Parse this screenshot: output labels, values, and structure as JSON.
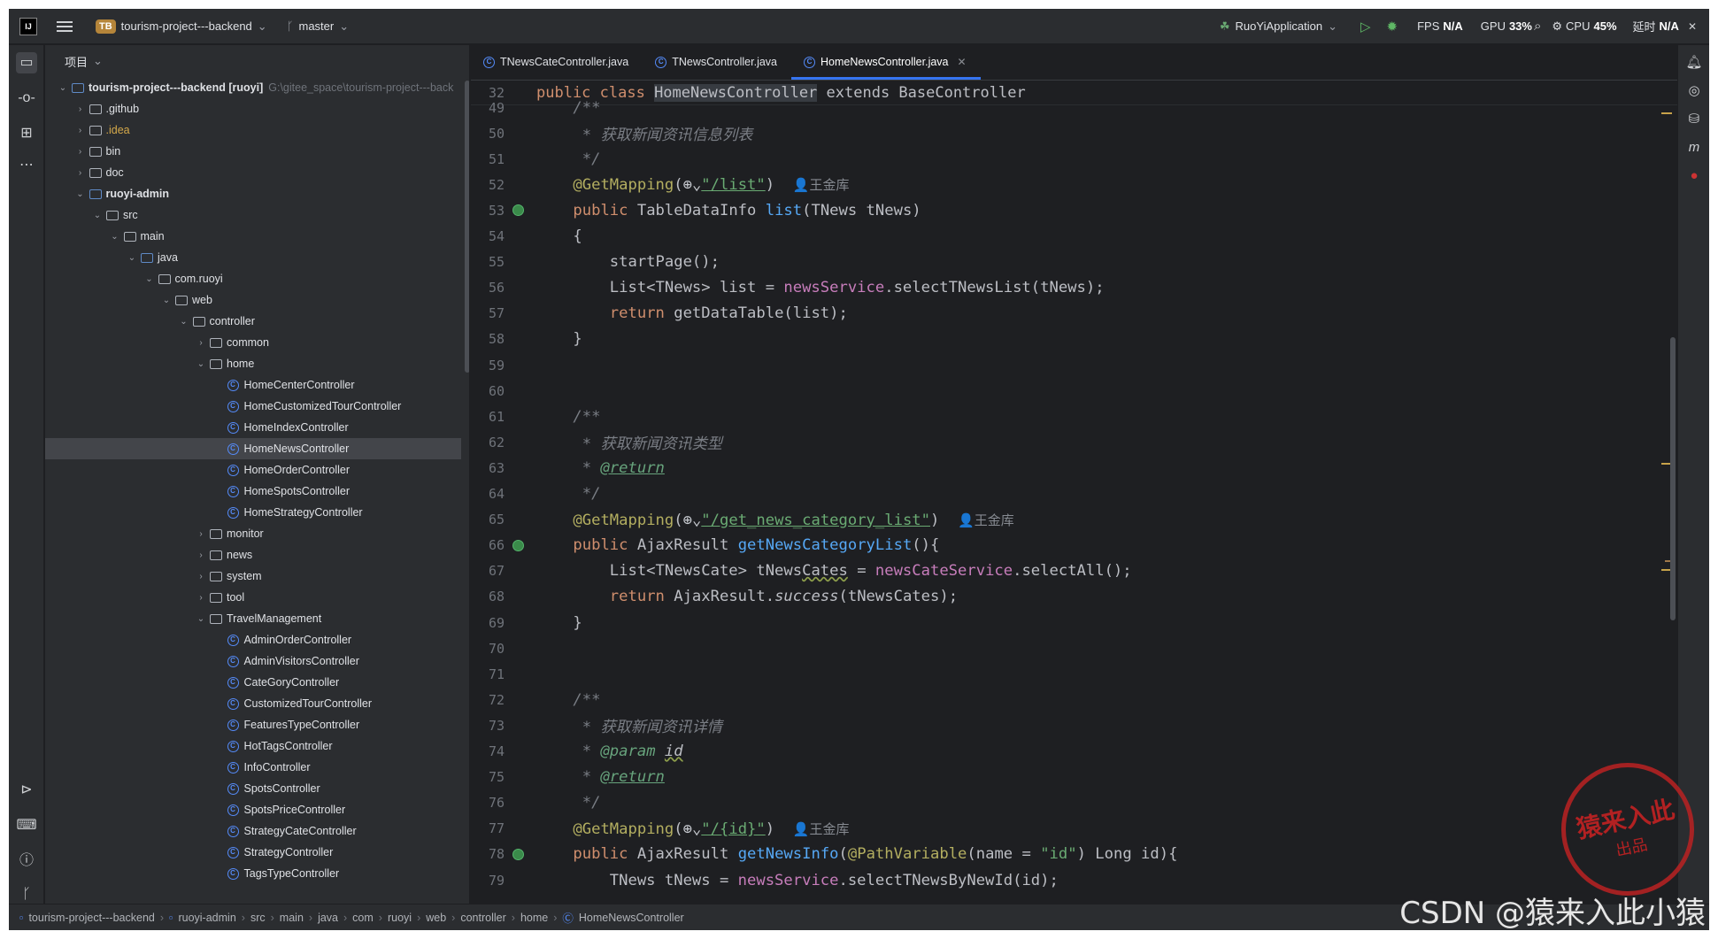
{
  "titlebar": {
    "project_badge": "TB",
    "project_name": "tourism-project---backend",
    "branch": "master",
    "run_config": "RuoYiApplication",
    "fps_label": "FPS",
    "fps_value": "N/A",
    "gpu_label": "GPU",
    "gpu_value": "33%",
    "cpu_label": "CPU",
    "cpu_value": "45%",
    "time_label": "延时",
    "time_value": "N/A"
  },
  "project_panel": {
    "title": "项目",
    "tree": [
      {
        "indent": 0,
        "chev": "v",
        "icon": "module",
        "label": "tourism-project---backend [ruoyi]",
        "hint": "G:\\gitee_space\\tourism-project---back",
        "bold": true
      },
      {
        "indent": 1,
        "chev": ">",
        "icon": "folder",
        "label": ".github"
      },
      {
        "indent": 1,
        "chev": ">",
        "icon": "folder",
        "label": ".idea",
        "cls": "idea-c"
      },
      {
        "indent": 1,
        "chev": ">",
        "icon": "folder",
        "label": "bin"
      },
      {
        "indent": 1,
        "chev": ">",
        "icon": "folder",
        "label": "doc"
      },
      {
        "indent": 1,
        "chev": "v",
        "icon": "module",
        "label": "ruoyi-admin",
        "bold": true
      },
      {
        "indent": 2,
        "chev": "v",
        "icon": "folder",
        "label": "src"
      },
      {
        "indent": 3,
        "chev": "v",
        "icon": "folder",
        "label": "main"
      },
      {
        "indent": 4,
        "chev": "v",
        "icon": "module",
        "label": "java"
      },
      {
        "indent": 5,
        "chev": "v",
        "icon": "package",
        "label": "com.ruoyi"
      },
      {
        "indent": 6,
        "chev": "v",
        "icon": "package",
        "label": "web"
      },
      {
        "indent": 7,
        "chev": "v",
        "icon": "package",
        "label": "controller"
      },
      {
        "indent": 8,
        "chev": ">",
        "icon": "package",
        "label": "common"
      },
      {
        "indent": 8,
        "chev": "v",
        "icon": "package",
        "label": "home"
      },
      {
        "indent": 9,
        "chev": "",
        "icon": "class",
        "label": "HomeCenterController"
      },
      {
        "indent": 9,
        "chev": "",
        "icon": "class",
        "label": "HomeCustomizedTourController"
      },
      {
        "indent": 9,
        "chev": "",
        "icon": "class",
        "label": "HomeIndexController"
      },
      {
        "indent": 9,
        "chev": "",
        "icon": "class",
        "label": "HomeNewsController",
        "selected": true
      },
      {
        "indent": 9,
        "chev": "",
        "icon": "class",
        "label": "HomeOrderController"
      },
      {
        "indent": 9,
        "chev": "",
        "icon": "class",
        "label": "HomeSpotsController"
      },
      {
        "indent": 9,
        "chev": "",
        "icon": "class",
        "label": "HomeStrategyController"
      },
      {
        "indent": 8,
        "chev": ">",
        "icon": "package",
        "label": "monitor"
      },
      {
        "indent": 8,
        "chev": ">",
        "icon": "package",
        "label": "news"
      },
      {
        "indent": 8,
        "chev": ">",
        "icon": "package",
        "label": "system"
      },
      {
        "indent": 8,
        "chev": ">",
        "icon": "package",
        "label": "tool"
      },
      {
        "indent": 8,
        "chev": "v",
        "icon": "package",
        "label": "TravelManagement"
      },
      {
        "indent": 9,
        "chev": "",
        "icon": "class",
        "label": "AdminOrderController"
      },
      {
        "indent": 9,
        "chev": "",
        "icon": "class",
        "label": "AdminVisitorsController"
      },
      {
        "indent": 9,
        "chev": "",
        "icon": "class",
        "label": "CateGoryController"
      },
      {
        "indent": 9,
        "chev": "",
        "icon": "class",
        "label": "CustomizedTourController"
      },
      {
        "indent": 9,
        "chev": "",
        "icon": "class",
        "label": "FeaturesTypeController"
      },
      {
        "indent": 9,
        "chev": "",
        "icon": "class",
        "label": "HotTagsController"
      },
      {
        "indent": 9,
        "chev": "",
        "icon": "class",
        "label": "InfoController"
      },
      {
        "indent": 9,
        "chev": "",
        "icon": "class",
        "label": "SpotsController"
      },
      {
        "indent": 9,
        "chev": "",
        "icon": "class",
        "label": "SpotsPriceController"
      },
      {
        "indent": 9,
        "chev": "",
        "icon": "class",
        "label": "StrategyCateController"
      },
      {
        "indent": 9,
        "chev": "",
        "icon": "class",
        "label": "StrategyController"
      },
      {
        "indent": 9,
        "chev": "",
        "icon": "class",
        "label": "TagsTypeController"
      }
    ]
  },
  "editor": {
    "tabs": [
      {
        "label": "TNewsCateController.java",
        "active": false
      },
      {
        "label": "TNewsController.java",
        "active": false
      },
      {
        "label": "HomeNewsController.java",
        "active": true
      }
    ],
    "inspections": {
      "warnings": "11",
      "weak": "4",
      "ok": "1"
    },
    "sticky": {
      "ln": "32",
      "pre": "public class ",
      "name": "HomeNewsController",
      "post": " extends BaseController"
    },
    "author": "王金库",
    "lines": [
      {
        "n": "49",
        "html": "    <span class=\"cm\">/**</span>"
      },
      {
        "n": "50",
        "html": "     <span class=\"cm\">* 获取新闻资讯信息列表</span>"
      },
      {
        "n": "51",
        "html": "     <span class=\"cm\">*/</span>"
      },
      {
        "n": "52",
        "html": "    <span class=\"an\">@GetMapping</span>(<span class=\"gl\">⊕⌄</span><span class=\"url\">\"/list\"</span>)  <span class=\"au\">👤王金库</span>"
      },
      {
        "n": "53",
        "g": true,
        "html": "    <span class=\"kw\">public</span> TableDataInfo <span class=\"fn\">list</span>(TNews tNews)"
      },
      {
        "n": "54",
        "html": "    {"
      },
      {
        "n": "55",
        "html": "        startPage();"
      },
      {
        "n": "56",
        "html": "        List&lt;TNews&gt; list = <span class=\"fd\">newsService</span>.selectTNewsList(tNews);"
      },
      {
        "n": "57",
        "html": "        <span class=\"kw\">return</span> getDataTable(list);"
      },
      {
        "n": "58",
        "html": "    }"
      },
      {
        "n": "59",
        "html": ""
      },
      {
        "n": "60",
        "html": ""
      },
      {
        "n": "61",
        "html": "    <span class=\"cm\">/**</span>"
      },
      {
        "n": "62",
        "html": "     <span class=\"cm\">* 获取新闻资讯类型</span>"
      },
      {
        "n": "63",
        "html": "     <span class=\"cm\">* </span><span class=\"tg it\">@return</span>"
      },
      {
        "n": "64",
        "html": "     <span class=\"cm\">*/</span>"
      },
      {
        "n": "65",
        "html": "    <span class=\"an\">@GetMapping</span>(<span class=\"gl\">⊕⌄</span><span class=\"url\">\"/get_news_category_list\"</span>)  <span class=\"au\">👤王金库</span>"
      },
      {
        "n": "66",
        "g": true,
        "html": "    <span class=\"kw\">public</span> AjaxResult <span class=\"fn\">getNewsCategoryList</span>(){"
      },
      {
        "n": "67",
        "html": "        List&lt;TNewsCate&gt; tNews<span class=\"ul\">Cates</span> = <span class=\"fd\">newsCateService</span>.selectAll();"
      },
      {
        "n": "68",
        "html": "        <span class=\"kw\">return</span> AjaxResult.<span class=\"it\">success</span>(tNewsCates);"
      },
      {
        "n": "69",
        "html": "    }"
      },
      {
        "n": "70",
        "html": ""
      },
      {
        "n": "71",
        "html": ""
      },
      {
        "n": "72",
        "html": "    <span class=\"cm\">/**</span>"
      },
      {
        "n": "73",
        "html": "     <span class=\"cm\">* 获取新闻资讯详情</span>"
      },
      {
        "n": "74",
        "html": "     <span class=\"cm\">* </span><span class=\"tg it\" style=\"text-decoration:none\">@param</span> <span class=\"cm ul\" style=\"color:#bcbec4\">id</span>"
      },
      {
        "n": "75",
        "html": "     <span class=\"cm\">* </span><span class=\"tg it\">@return</span>"
      },
      {
        "n": "76",
        "html": "     <span class=\"cm\">*/</span>"
      },
      {
        "n": "77",
        "html": "    <span class=\"an\">@GetMapping</span>(<span class=\"gl\">⊕⌄</span><span class=\"url\">\"/{id}\"</span>)  <span class=\"au\">👤王金库</span>"
      },
      {
        "n": "78",
        "g": true,
        "html": "    <span class=\"kw\">public</span> AjaxResult <span class=\"fn\">getNewsInfo</span>(<span class=\"an\">@PathVariable</span>(name = <span class=\"st\">\"id\"</span>) Long id){"
      },
      {
        "n": "79",
        "html": "        TNews tNews = <span class=\"fd\">newsService</span>.selectTNewsByNewId(id);"
      }
    ]
  },
  "statusbar": {
    "crumbs": [
      "tourism-project---backend",
      "ruoyi-admin",
      "src",
      "main",
      "java",
      "com",
      "ruoyi",
      "web",
      "controller",
      "home",
      "HomeNewsController"
    ]
  },
  "watermark": "CSDN @猿来入此小猿",
  "stamp": {
    "line1": "猿来入此",
    "line2": "出品"
  }
}
